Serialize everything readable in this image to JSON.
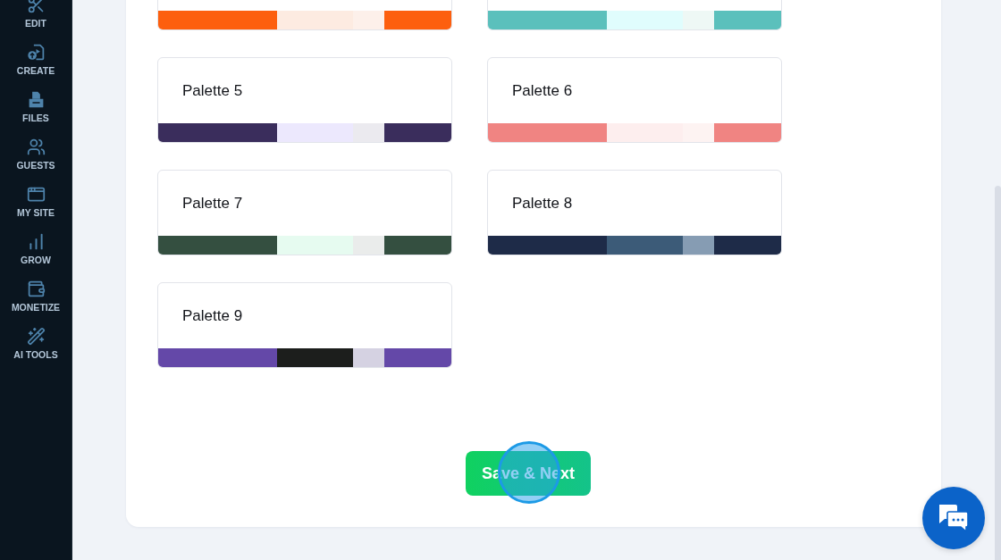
{
  "sidebar": {
    "items": [
      {
        "label": "EDIT"
      },
      {
        "label": "CREATE"
      },
      {
        "label": "FILES"
      },
      {
        "label": "GUESTS"
      },
      {
        "label": "MY SITE"
      },
      {
        "label": "GROW"
      },
      {
        "label": "MONETIZE"
      },
      {
        "label": "AI TOOLS"
      }
    ]
  },
  "palettes": [
    {
      "swatches": [
        {
          "color": "#fd5f0e"
        },
        {
          "color": "#fdebe1"
        },
        {
          "color": "#fdf0ea"
        },
        {
          "color": "#fd5f0e"
        }
      ]
    },
    {
      "swatches": [
        {
          "color": "#5bc0bc"
        },
        {
          "color": "#e0fdfd"
        },
        {
          "color": "#eef8f5"
        },
        {
          "color": "#5bc0bc"
        }
      ]
    },
    {
      "title": "Palette 5",
      "swatches": [
        {
          "color": "#3a2d5c"
        },
        {
          "color": "#ece8fd"
        },
        {
          "color": "#ebeaef"
        },
        {
          "color": "#3a2d5c"
        }
      ]
    },
    {
      "title": "Palette 6",
      "swatches": [
        {
          "color": "#f08482"
        },
        {
          "color": "#fdeeee"
        },
        {
          "color": "#fdf3f2"
        },
        {
          "color": "#f08482"
        }
      ]
    },
    {
      "title": "Palette 7",
      "swatches": [
        {
          "color": "#344f40"
        },
        {
          "color": "#e6fbf0"
        },
        {
          "color": "#eaeceb"
        },
        {
          "color": "#344f40"
        }
      ]
    },
    {
      "title": "Palette 8",
      "swatches": [
        {
          "color": "#1e2b48"
        },
        {
          "color": "#3c5b78"
        },
        {
          "color": "#869cb3"
        },
        {
          "color": "#1e2b48"
        }
      ]
    },
    {
      "title": "Palette 9",
      "swatches": [
        {
          "color": "#6448a8"
        },
        {
          "color": "#1c1e1c"
        },
        {
          "color": "#d5d2e2"
        },
        {
          "color": "#6448a8"
        }
      ]
    }
  ],
  "save_button": {
    "label": "Save & Next",
    "click_marker": true
  }
}
